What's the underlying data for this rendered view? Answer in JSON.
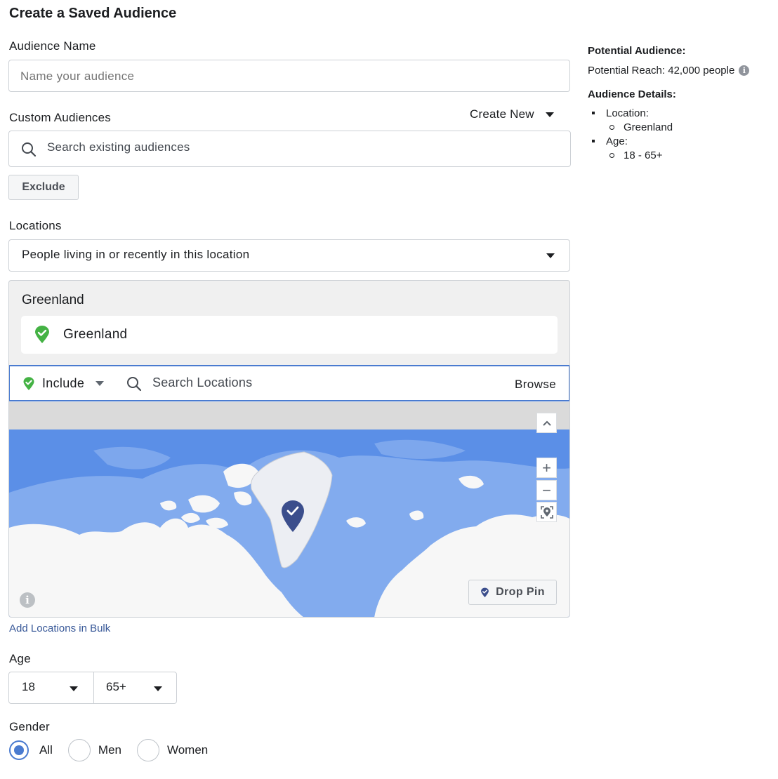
{
  "page": {
    "title": "Create a Saved Audience"
  },
  "audience_name": {
    "label": "Audience Name",
    "placeholder": "Name your audience",
    "value": ""
  },
  "custom_audiences": {
    "label": "Custom Audiences",
    "create_new_label": "Create New",
    "search_placeholder": "Search existing audiences",
    "exclude_label": "Exclude"
  },
  "locations": {
    "label": "Locations",
    "mode_selected": "People living in or recently in this location",
    "group_title": "Greenland",
    "selected_items": [
      "Greenland"
    ],
    "include_label": "Include",
    "search_placeholder": "Search Locations",
    "browse_label": "Browse",
    "drop_pin_label": "Drop Pin",
    "add_bulk_link": "Add Locations in Bulk",
    "map": {
      "pin_location": "Greenland",
      "controls": [
        "collapse-icon",
        "zoom-in-icon",
        "zoom-out-icon",
        "locate-icon",
        "info-icon"
      ]
    }
  },
  "age": {
    "label": "Age",
    "min_selected": "18",
    "max_selected": "65+"
  },
  "gender": {
    "label": "Gender",
    "options": [
      {
        "label": "All",
        "checked": true
      },
      {
        "label": "Men",
        "checked": false
      },
      {
        "label": "Women",
        "checked": false
      }
    ]
  },
  "sidebar": {
    "potential_heading": "Potential Audience:",
    "potential_reach": "Potential Reach: 42,000 people",
    "details_heading": "Audience Details:",
    "details": [
      {
        "label": "Location:",
        "children": [
          "Greenland"
        ]
      },
      {
        "label": "Age:",
        "children": [
          "18 - 65+"
        ]
      }
    ]
  },
  "colors": {
    "accent_blue": "#4a7bd0",
    "link_blue": "#385898",
    "include_green": "#44b244",
    "map_ocean": "#5a8fe6",
    "map_land": "#f7f7f7",
    "pin_navy": "#3b4e8c"
  }
}
